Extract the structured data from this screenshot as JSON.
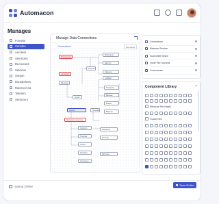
{
  "app": {
    "brand": "Automacon"
  },
  "sidebar": {
    "title": "Manages",
    "items": [
      {
        "label": "Foreeke",
        "active": false
      },
      {
        "label": "Soredes",
        "active": true
      },
      {
        "label": "Aendess",
        "active": false
      },
      {
        "label": "Seerscets",
        "active": false
      },
      {
        "label": "Recsocans",
        "active": false
      },
      {
        "label": "Sateiciei",
        "active": false
      },
      {
        "label": "Surgun",
        "active": false
      },
      {
        "label": "Duradoriees",
        "active": false
      },
      {
        "label": "Ratenvor Sa",
        "active": false
      },
      {
        "label": "Teileters",
        "active": false
      },
      {
        "label": "Sentecurs",
        "active": false
      }
    ]
  },
  "main": {
    "title": "Manage Data Connections",
    "canvas_label": "Connections",
    "zoom": "Serreleae",
    "nodes": [
      {
        "label": "Microsaeesre",
        "style": "red"
      },
      {
        "label": "Miiowsanen",
        "style": "default"
      },
      {
        "label": "Eanccrn",
        "style": "default"
      },
      {
        "label": "Soetuarvatre",
        "style": "default"
      },
      {
        "label": "Hleoeevs",
        "style": "default"
      },
      {
        "label": "Lastbeer",
        "style": "default"
      },
      {
        "label": "Aemenore",
        "style": "red"
      },
      {
        "label": "Rauwsos",
        "style": "default"
      },
      {
        "label": "Sncaeeoe",
        "style": "default"
      },
      {
        "label": "Tesrtd",
        "style": "default"
      },
      {
        "label": "Bleoeee",
        "style": "default"
      },
      {
        "label": "Brakss",
        "style": "default"
      },
      {
        "label": "Baeeore",
        "style": "default"
      },
      {
        "label": "Ovenstae",
        "style": "default"
      },
      {
        "label": "Dneme",
        "style": "blue"
      },
      {
        "label": "Dataweer Lennerecs",
        "style": "note"
      },
      {
        "label": "Cestriom",
        "style": "default"
      },
      {
        "label": "Rnesiuroe",
        "style": "default"
      },
      {
        "label": "Tnannsa",
        "style": "default"
      },
      {
        "label": "Ennreee",
        "style": "default"
      },
      {
        "label": "Snsiee",
        "style": "default"
      },
      {
        "label": "Sseoieee",
        "style": "default"
      },
      {
        "label": "Ceetsnsea",
        "style": "default"
      },
      {
        "label": "Sarossee",
        "style": "default"
      }
    ]
  },
  "right_panel": {
    "items": [
      {
        "label": "Coneesecee"
      },
      {
        "label": "Metonne Seretee"
      },
      {
        "label": "Gconnelee Sesee"
      },
      {
        "label": "Vonte Fee Scocess"
      },
      {
        "label": "Conennenee"
      }
    ]
  },
  "library": {
    "title": "Component Library",
    "select_label": "Mlencue Pre-Naalit",
    "select_label_2": "Cuconrnek"
  },
  "footer": {
    "left_label": "Saeup Dritter",
    "save_label": "Save Dritter"
  }
}
